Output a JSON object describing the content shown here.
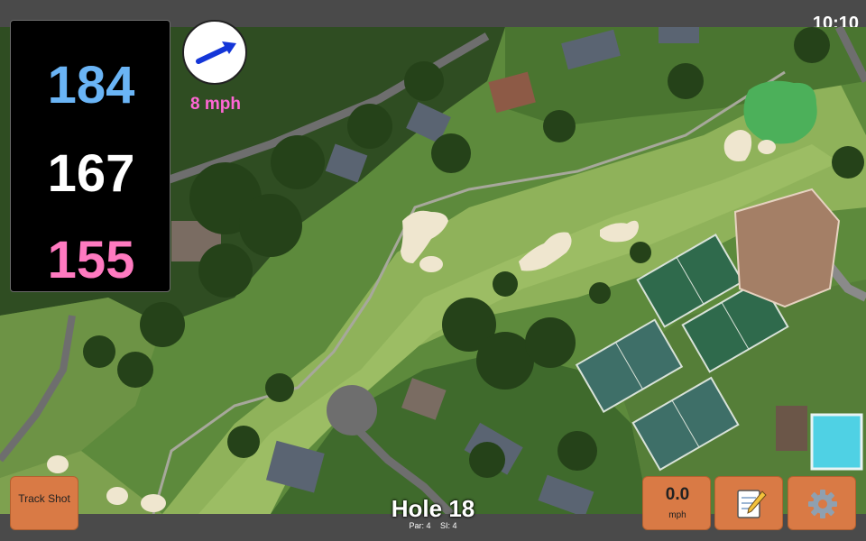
{
  "status_bar": {
    "time": "10:10"
  },
  "distances": {
    "back": "184",
    "middle": "167",
    "front": "155"
  },
  "wind": {
    "speed_label": "8 mph",
    "direction_icon": "arrow-icon"
  },
  "hole": {
    "title": "Hole 18",
    "par": "Par: 4",
    "stroke_index": "SI: 4"
  },
  "buttons": {
    "track_shot": "Track Shot",
    "speed_value": "0.0",
    "speed_unit": "mph",
    "notes_icon": "notepad-icon",
    "settings_icon": "gear-icon"
  },
  "colors": {
    "back_distance": "#6ab4f5",
    "middle_distance": "#ffffff",
    "front_distance": "#ff7ac0",
    "wind_label": "#ff66d4",
    "button_bg": "#d97a45",
    "bar_bg": "#4a4a4a"
  }
}
